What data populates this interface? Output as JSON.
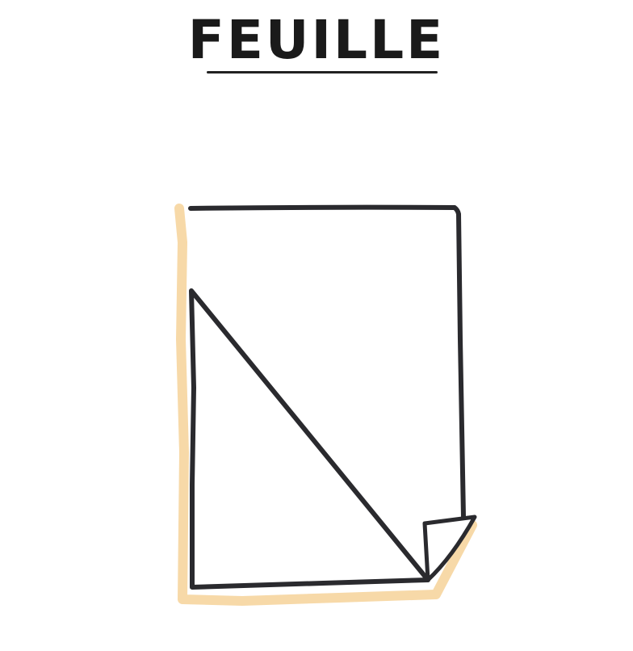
{
  "title": "FEUILLE",
  "colors": {
    "outline": "#2a2a2e",
    "shadow": "#f7d9a8",
    "paper": "#ffffff"
  },
  "icon": "paper-sheet-icon"
}
